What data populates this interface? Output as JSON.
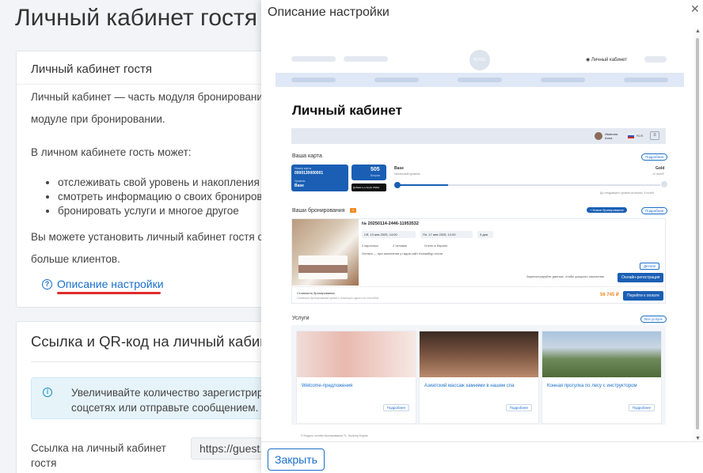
{
  "page": {
    "title": "Личный кабинет гостя"
  },
  "card1": {
    "title": "Личный кабинет гостя",
    "p1": "Личный кабинет — часть модуля бронирования",
    "p1b": "модуле при бронировании.",
    "p2": "В личном кабинете гость может:",
    "bullets": [
      "отслеживать свой уровень и накопления в",
      "смотреть информацию о своих бронирова",
      "бронировать услуги и многое другое"
    ],
    "p3": "Вы можете установить личный кабинет гостя от",
    "p3b": "больше клиентов.",
    "help_link": "Описание настройки"
  },
  "card2": {
    "title": "Ссылка и QR-код на личный кабин",
    "info": [
      "Увеличивайте количество зарегистрирова",
      "соцсетях или отправьте сообщением."
    ],
    "link_label": [
      "Ссылка на личный кабинет",
      "гостя"
    ],
    "link_value": "https://guest."
  },
  "modal": {
    "title": "Описание настройки",
    "close_label": "Закрыть",
    "preview": {
      "hotel_logo": "HOTEL",
      "account_link": "Личный кабинет",
      "heading": "Личный кабинет",
      "user_name": "Иванова Анна",
      "lang": "RUS",
      "card_section": "Ваша карта",
      "card_details": "Подробнее",
      "card_number_label": "Номер карты",
      "card_number": "0000130000001",
      "card_level_label": "Уровень",
      "card_level": "Base",
      "bonus_value": "505",
      "bonus_label": "Бонусы",
      "store_label": "Добавить в Apple Wallet",
      "level_from": "Base",
      "level_from_sub": "Начальный уровень",
      "level_to": "Gold",
      "level_to_sub": "10 ночей",
      "level_hint": "До следующего уровня осталось: 3 ночей",
      "bookings_section": "Ваши бронирования",
      "bookings_badge": "1",
      "new_booking_btn": "+ Новое бронирование",
      "bookings_more": "Подробнее",
      "booking_number": "№ 20250114-2446-11953532",
      "checkin": "Сб, 13 янв 2025, 14:00",
      "checkout": "Пн, 17 янв 2025, 12:00",
      "nights": "3 дня",
      "room_info": "2 взрослых",
      "guests_info": "2 человек",
      "meal_info": "Отель в Европе",
      "payment_info": "Оплата — при заселении у гидов сайт Каламбур отеля",
      "details_btn": "Детали",
      "checkin_hint": "Зарегистрируйте данные, чтобы ускорить заселение",
      "online_checkin_btn": "Онлайн-регистрация",
      "cost_label": "Стоимость бронирования",
      "cost_sub": "Оплачено бронирование прямо с помощью одного из способов",
      "cost_value": "56 745 ₽",
      "pay_btn": "Перейти к оплате",
      "services_section": "Услуги",
      "services_all": "Все услуги",
      "services": [
        "Welcome-предложения",
        "Азиатский массаж камнями в нашем спа",
        "Конная прогулка по лесу с инструктором"
      ],
      "service_more": "Подробнее",
      "footer_note": "© Модуль онлайн-бронирования TL: Booking Engine"
    }
  },
  "colors": {
    "accent": "#1a6fc9",
    "underline": "#e12b2b",
    "bg": "#f2f4f7"
  }
}
